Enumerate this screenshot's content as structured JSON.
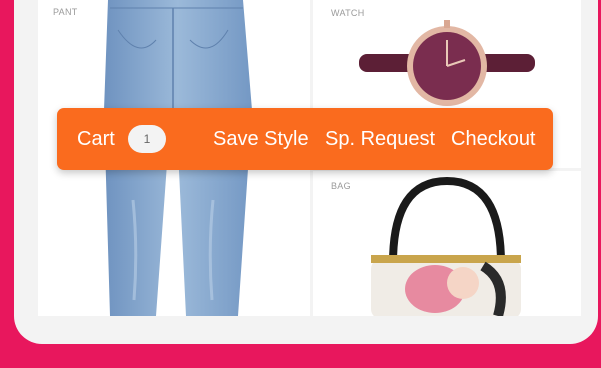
{
  "products": {
    "pant": {
      "label": "PANT"
    },
    "watch": {
      "label": "WATCH"
    },
    "bag": {
      "label": "BAG"
    }
  },
  "toolbar": {
    "cart_label": "Cart",
    "cart_count": "1",
    "save_style_label": "Save Style",
    "special_request_label": "Sp. Request",
    "checkout_label": "Checkout"
  },
  "colors": {
    "background": "#e8175d",
    "toolbar": "#fa6b1e",
    "card": "#f3f3f3"
  }
}
